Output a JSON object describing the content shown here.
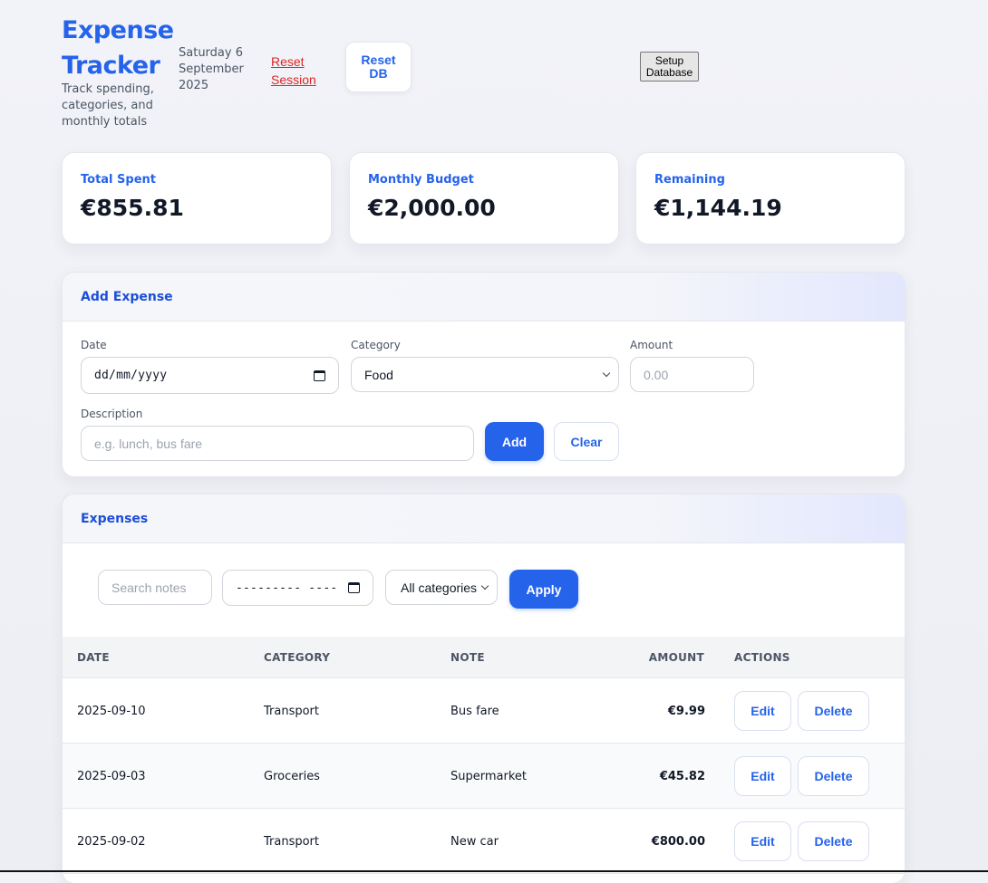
{
  "header": {
    "title": "Expense Tracker",
    "subtitle": "Track spending, categories, and monthly totals",
    "date": "Saturday 6 September 2025",
    "reset_session": "Reset Session",
    "reset_db": "Reset DB",
    "setup_db": "Setup Database"
  },
  "stats": [
    {
      "label": "Total Spent",
      "value": "€855.81"
    },
    {
      "label": "Monthly Budget",
      "value": "€2,000.00"
    },
    {
      "label": "Remaining",
      "value": "€1,144.19"
    }
  ],
  "add_expense": {
    "title": "Add Expense",
    "date_label": "Date",
    "date_placeholder": "dd/mm/yyyy",
    "category_label": "Category",
    "category_value": "Food",
    "amount_label": "Amount",
    "amount_placeholder": "0.00",
    "description_label": "Description",
    "description_placeholder": "e.g. lunch, bus fare",
    "add_label": "Add",
    "clear_label": "Clear"
  },
  "expenses": {
    "title": "Expenses",
    "search_placeholder": "Search notes",
    "month_placeholder": "---------  ----",
    "category_filter": "All categories",
    "apply_label": "Apply",
    "columns": [
      "DATE",
      "CATEGORY",
      "NOTE",
      "AMOUNT",
      "ACTIONS"
    ],
    "edit_label": "Edit",
    "delete_label": "Delete",
    "rows": [
      {
        "date": "2025-09-10",
        "category": "Transport",
        "note": "Bus fare",
        "amount": "€9.99"
      },
      {
        "date": "2025-09-03",
        "category": "Groceries",
        "note": "Supermarket",
        "amount": "€45.82"
      },
      {
        "date": "2025-09-02",
        "category": "Transport",
        "note": "New car",
        "amount": "€800.00"
      }
    ]
  },
  "colors": {
    "accent": "#2563eb",
    "danger": "#dc2626",
    "background": "#f0f1f6"
  }
}
